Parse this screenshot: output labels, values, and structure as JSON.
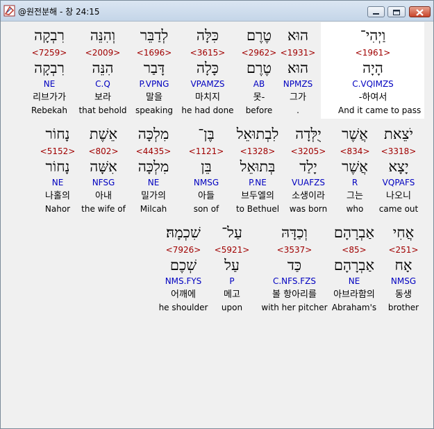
{
  "window": {
    "title": "@원전분해 - 창 24:15"
  },
  "rows": [
    [
      {
        "heb": "וַיְהִי־",
        "num": "<1961>",
        "lex": "הָיָה",
        "morph": "C.VQIMZS",
        "kor": "-하여서",
        "eng": "And it came to pass"
      },
      {
        "heb": "הוּא",
        "num": "<1931>",
        "lex": "הוּא",
        "morph": "NPMZS",
        "kor": "그가",
        "eng": "."
      },
      {
        "heb": "טֶרֶם",
        "num": "<2962>",
        "lex": "טֶרֶם",
        "morph": "AB",
        "kor": "못-",
        "eng": "before"
      },
      {
        "heb": "כִּלָּה",
        "num": "<3615>",
        "lex": "כָּלָה",
        "morph": "VPAMZS",
        "kor": "마치지",
        "eng": "he had done"
      },
      {
        "heb": "לְדַבֵּר",
        "num": "<1696>",
        "lex": "דָּבַר",
        "morph": "P.VPNG",
        "kor": "말을",
        "eng": "speaking"
      },
      {
        "heb": "וְהִנֵּה",
        "num": "<2009>",
        "lex": "הִנֵּה",
        "morph": "C.Q",
        "kor": "보라",
        "eng": "that behold"
      },
      {
        "heb": "רִבְקָה",
        "num": "<7259>",
        "lex": "רִבְקָה",
        "morph": "NE",
        "kor": "리브가가",
        "eng": "Rebekah"
      }
    ],
    [
      {
        "heb": "יֹצֵאת",
        "num": "<3318>",
        "lex": "יָצָא",
        "morph": "VQPAFS",
        "kor": "나오니",
        "eng": "came out"
      },
      {
        "heb": "אֲשֶׁר",
        "num": "<834>",
        "lex": "אֲשֶׁר",
        "morph": "R",
        "kor": "그는",
        "eng": "who"
      },
      {
        "heb": "יֻלְּדָה",
        "num": "<3205>",
        "lex": "יָלַד",
        "morph": "VUAFZS",
        "kor": "소생이라",
        "eng": "was born"
      },
      {
        "heb": "לִבְתוּאֵל",
        "num": "<1328>",
        "lex": "בְּתוּאֵל",
        "morph": "P.NE",
        "kor": "브두엘의",
        "eng": "to Bethuel"
      },
      {
        "heb": "בֶּן־",
        "num": "<1121>",
        "lex": "בֵּן",
        "morph": "NMSG",
        "kor": "아들",
        "eng": "son of"
      },
      {
        "heb": "מִלְכָּה",
        "num": "<4435>",
        "lex": "מִלְכָּה",
        "morph": "NE",
        "kor": "밀가의",
        "eng": "Milcah"
      },
      {
        "heb": "אֵשֶׁת",
        "num": "<802>",
        "lex": "אִשָּׁה",
        "morph": "NFSG",
        "kor": "아내",
        "eng": "the wife of"
      },
      {
        "heb": "נָחוֹר",
        "num": "<5152>",
        "lex": "נָחוֹר",
        "morph": "NE",
        "kor": "나홀의",
        "eng": "Nahor"
      }
    ],
    [
      {
        "heb": "אֲחִי",
        "num": "<251>",
        "lex": "אָח",
        "morph": "NMSG",
        "kor": "동생",
        "eng": "brother"
      },
      {
        "heb": "אַבְרָהָם",
        "num": "<85>",
        "lex": "אַבְרָהָם",
        "morph": "NE",
        "kor": "아브라함의",
        "eng": "Abraham's"
      },
      {
        "heb": "וְכַדָּהּ",
        "num": "<3537>",
        "lex": "כַּד",
        "morph": "C.NFS.FZS",
        "kor": "볼 항아리를",
        "eng": "with her pitcher"
      },
      {
        "heb": "עַל־",
        "num": "<5921>",
        "lex": "עַל",
        "morph": "P",
        "kor": "메고",
        "eng": "upon"
      },
      {
        "heb": "שִׁכְמָהּ׃",
        "num": "<7926>",
        "lex": "שְׁכֶם",
        "morph": "NMS.FYS",
        "kor": "어깨에",
        "eng": "he shoulder"
      }
    ]
  ]
}
